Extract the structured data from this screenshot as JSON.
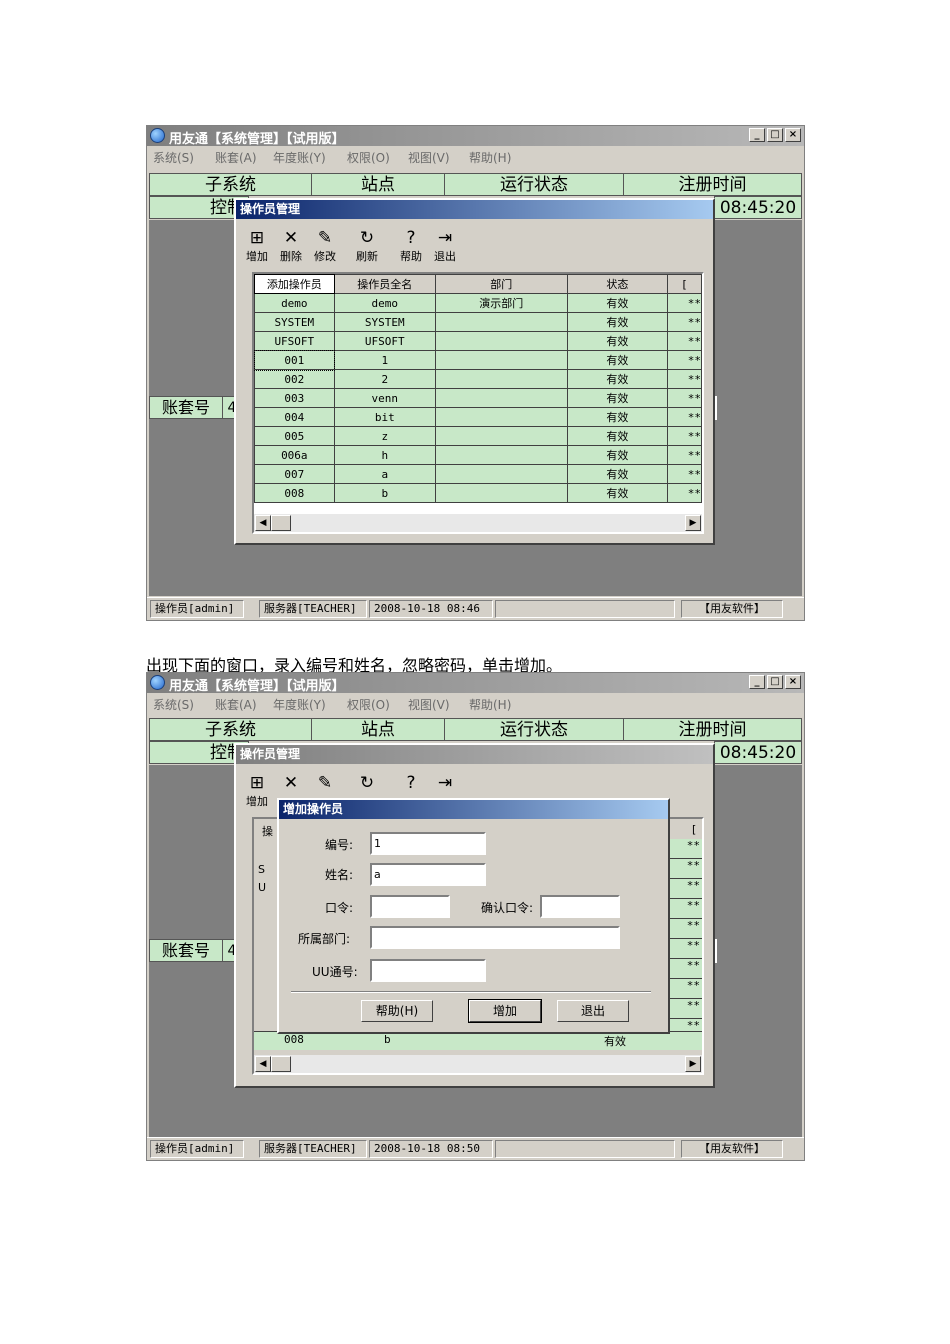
{
  "app": {
    "title": "用友通【系统管理】【试用版】",
    "window_buttons": [
      "_",
      "□",
      "×"
    ],
    "menu": [
      "系统(S)",
      "账套(A)",
      "年度账(Y)",
      "权限(O)",
      "视图(V)",
      "帮助(H)"
    ],
    "header_cols": [
      "子系统",
      "站点",
      "运行状态",
      "注册时间"
    ],
    "row2_left": "控制",
    "row2_time": "08:45:20",
    "lower_header": "账套号",
    "lower_header_frag": "4"
  },
  "shot1": {
    "status": [
      "操作员[admin]",
      "服务器[TEACHER]",
      "2008-10-18 08:46",
      "",
      "【用友软件】"
    ]
  },
  "shot2": {
    "status": [
      "操作员[admin]",
      "服务器[TEACHER]",
      "2008-10-18 08:50",
      "",
      "【用友软件】"
    ]
  },
  "operator_dialog": {
    "title": "操作员管理",
    "toolbar": [
      "增加",
      "删除",
      "修改",
      "刷新",
      "帮助",
      "退出"
    ],
    "tooltip": "添加操作员",
    "columns": [
      "添加操作员",
      "操作员全名",
      "部门",
      "状态",
      "["
    ],
    "rows": [
      [
        "demo",
        "demo",
        "演示部门",
        "有效",
        "**"
      ],
      [
        "SYSTEM",
        "SYSTEM",
        "",
        "有效",
        "**"
      ],
      [
        "UFSOFT",
        "UFSOFT",
        "",
        "有效",
        "**"
      ],
      [
        "001",
        "1",
        "",
        "有效",
        "**"
      ],
      [
        "002",
        "2",
        "",
        "有效",
        "**"
      ],
      [
        "003",
        "venn",
        "",
        "有效",
        "**"
      ],
      [
        "004",
        "bit",
        "",
        "有效",
        "**"
      ],
      [
        "005",
        "z",
        "",
        "有效",
        "**"
      ],
      [
        "006a",
        "h",
        "",
        "有效",
        "**"
      ],
      [
        "007",
        "a",
        "",
        "有效",
        "**"
      ],
      [
        "008",
        "b",
        "",
        "有效",
        "**"
      ]
    ],
    "bg_header_frag": "操",
    "bg_last_row": [
      "008",
      "b",
      "有效"
    ],
    "bg_right_frag": "[",
    "bg_left_frags": [
      "S",
      "U"
    ]
  },
  "caption": "出现下面的窗口，录入编号和姓名，忽略密码，单击增加。",
  "add_dialog": {
    "title": "增加操作员",
    "labels": {
      "id": "编号:",
      "name": "姓名:",
      "pwd": "口令:",
      "confirm": "确认口令:",
      "dept": "所属部门:",
      "uu": "UU通号:"
    },
    "values": {
      "id": "1",
      "name": "a",
      "pwd": "",
      "confirm": "",
      "dept": "",
      "uu": ""
    },
    "buttons": {
      "help": "帮助(H)",
      "add": "增加",
      "exit": "退出"
    }
  }
}
